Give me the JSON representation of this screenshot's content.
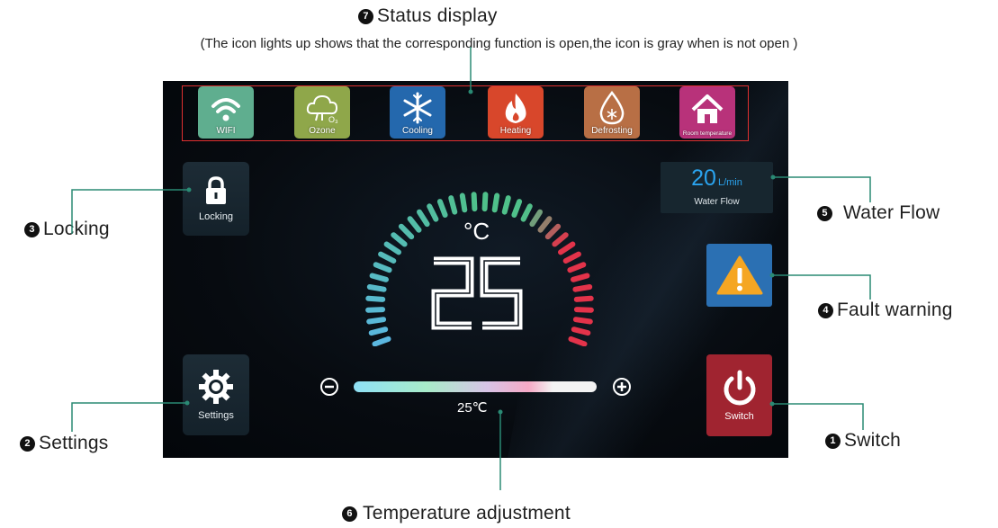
{
  "callouts": {
    "status_display": {
      "num": "7",
      "label": "Status display"
    },
    "status_note": "(The icon lights up shows that the corresponding function is open,the icon is gray when is not open )",
    "locking": {
      "num": "3",
      "label": "Locking"
    },
    "water_flow": {
      "num": "5",
      "label": "Water Flow"
    },
    "fault_warning": {
      "num": "4",
      "label": "Fault warning"
    },
    "settings": {
      "num": "2",
      "label": "Settings"
    },
    "switch": {
      "num": "1",
      "label": "Switch"
    },
    "temperature_adjustment": {
      "num": "6",
      "label": "Temperature adjustment"
    }
  },
  "status_tiles": [
    {
      "label": "WIFI",
      "icon": "wifi-icon",
      "color": "#5fae8f"
    },
    {
      "label": "Ozone",
      "icon": "ozone-icon",
      "color": "#8fa74a"
    },
    {
      "label": "Cooling",
      "icon": "snowflake-icon",
      "color": "#2468ad"
    },
    {
      "label": "Heating",
      "icon": "flame-icon",
      "color": "#d8472b"
    },
    {
      "label": "Defrosting",
      "icon": "defrost-drop-icon",
      "color": "#b86f45"
    },
    {
      "label": "Room temperature",
      "icon": "house-icon",
      "color": "#b8327a"
    }
  ],
  "screen": {
    "locking_label": "Locking",
    "settings_label": "Settings",
    "water_flow_value": "20",
    "water_flow_unit": "L/min",
    "water_flow_label": "Water Flow",
    "temp_unit": "°C",
    "temp_value": "25",
    "switch_label": "Switch",
    "slider_value": "25℃"
  },
  "colors": {
    "frame": "#e03030",
    "callout_line": "#2a8a74",
    "gauge_cold": "#5bb7e0",
    "gauge_mid": "#4fc08a",
    "gauge_hot": "#e3334a"
  }
}
